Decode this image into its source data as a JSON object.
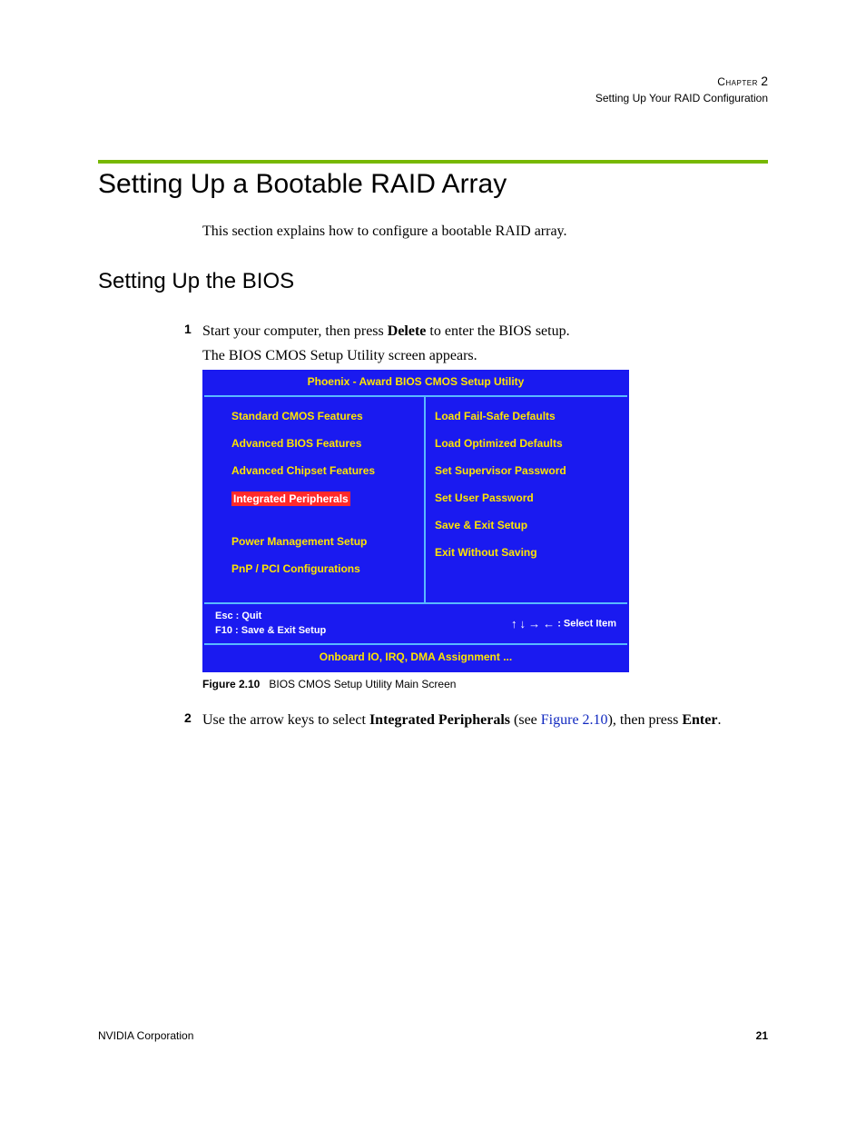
{
  "header": {
    "chapter_word": "Chapter",
    "chapter_num": "2",
    "chapter_title": "Setting Up Your RAID Configuration"
  },
  "h1": "Setting Up a Bootable RAID Array",
  "intro": "This section explains how to configure a bootable RAID array.",
  "h2": "Setting Up the BIOS",
  "step1": {
    "num": "1",
    "pre": "Start your computer, then press ",
    "bold": "Delete",
    "post": " to enter the BIOS setup.",
    "sub": "The BIOS CMOS Setup Utility screen appears."
  },
  "bios": {
    "title": "Phoenix - Award BIOS CMOS Setup Utility",
    "left": [
      "Standard CMOS Features",
      "Advanced BIOS Features",
      "Advanced Chipset Features",
      "Integrated Peripherals",
      "Power Management Setup",
      "PnP / PCI Configurations"
    ],
    "right": [
      "Load Fail-Safe Defaults",
      "Load Optimized Defaults",
      "Set Supervisor Password",
      "Set User Password",
      "Save & Exit Setup",
      "Exit Without Saving"
    ],
    "keys_left_1": "Esc : Quit",
    "keys_left_2": "F10 : Save & Exit Setup",
    "keys_right": ": Select Item",
    "bottom": "Onboard IO, IRQ, DMA Assignment ..."
  },
  "figcap": {
    "bold": "Figure 2.10",
    "text": "BIOS CMOS Setup Utility Main Screen"
  },
  "step2": {
    "num": "2",
    "pre": "Use the arrow keys to select ",
    "bold1": "Integrated Peripherals",
    "mid1": " (see ",
    "link": "Figure 2.10",
    "mid2": "), then press ",
    "bold2": "Enter",
    "post": "."
  },
  "footer": {
    "corp": "NVIDIA Corporation",
    "page": "21"
  }
}
